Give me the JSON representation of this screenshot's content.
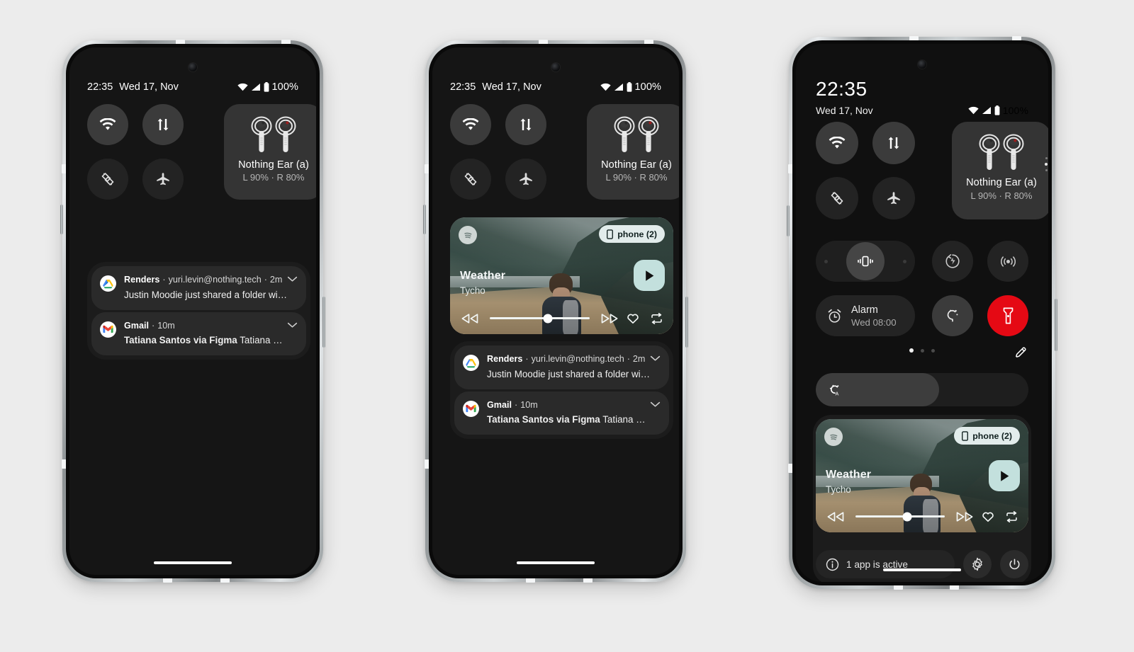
{
  "page": {
    "background_color": "#ececec",
    "device_count": 3
  },
  "status_bar": {
    "time": "22:35",
    "date": "Wed 17, Nov",
    "battery_percent": "100%",
    "icons": [
      "wifi-icon",
      "cellular-signal-icon",
      "battery-icon"
    ]
  },
  "quick_settings": {
    "tiles": [
      {
        "name": "wifi",
        "icon": "wifi-icon",
        "state": "on"
      },
      {
        "name": "mobile-data",
        "icon": "data-transfer-icon",
        "state": "on"
      },
      {
        "name": "auto-rotate",
        "icon": "auto-rotate-icon",
        "state": "off"
      },
      {
        "name": "airplane-mode",
        "icon": "airplane-icon",
        "state": "off"
      }
    ],
    "bluetooth_device": {
      "icon": "earbuds-icon",
      "name": "Nothing Ear (a)",
      "battery": "L 90% · R 80%"
    },
    "ringer_modes": [
      {
        "name": "silent",
        "icon": "mute-icon",
        "state": "off"
      },
      {
        "name": "vibrate",
        "icon": "vibrate-icon",
        "state": "on"
      },
      {
        "name": "ring",
        "icon": "ring-icon",
        "state": "off"
      }
    ],
    "extra_tiles": [
      {
        "name": "battery-share",
        "icon": "battery-share-icon",
        "state": "off"
      },
      {
        "name": "hotspot",
        "icon": "hotspot-icon",
        "state": "off"
      }
    ],
    "alarm": {
      "icon": "alarm-clock-icon",
      "label": "Alarm",
      "value": "Wed 08:00"
    },
    "colour_tile": {
      "name": "color-temperature",
      "icon": "color-temp-icon"
    },
    "flashlight": {
      "name": "flashlight",
      "icon": "flashlight-icon",
      "color": "#e50914",
      "state": "on"
    },
    "pages": {
      "count": 3,
      "current": 1
    },
    "edit_button": {
      "name": "edit-tiles",
      "icon": "pencil-icon"
    },
    "brightness": {
      "icon": "auto-brightness-icon",
      "value_percent": 58
    }
  },
  "notifications": [
    {
      "app": "Renders",
      "meta": "yuri.levin@nothing.tech",
      "time": "2m",
      "separator": "·",
      "body": "Justin Moodie just shared a folder with you",
      "icon": "google-drive-icon",
      "expand_icon": "chevron-down-icon"
    },
    {
      "app": "Gmail",
      "meta": "",
      "time": "10m",
      "separator": "·",
      "body_bold": "Tatiana Santos via Figma",
      "body": "Tatiana mention...",
      "icon": "gmail-icon",
      "expand_icon": "chevron-down-icon"
    }
  ],
  "media_player": {
    "app_icon": "spotify-icon",
    "device_chip": {
      "icon": "phone-icon",
      "label": "phone (2)"
    },
    "title": "Weather",
    "artist": "Tycho",
    "progress_percent": 58,
    "controls": [
      {
        "name": "rewind",
        "icon": "rewind-icon"
      },
      {
        "name": "fast-forward",
        "icon": "fast-forward-icon"
      },
      {
        "name": "favourite",
        "icon": "heart-icon"
      },
      {
        "name": "repeat",
        "icon": "repeat-icon"
      }
    ],
    "play_button": {
      "name": "play",
      "icon": "play-icon",
      "color": "#c3e0dd"
    },
    "artwork_description": "coastal-cliff-beach-photo"
  },
  "footer": {
    "active_apps": {
      "icon": "info-icon",
      "label": "1 app is active"
    },
    "settings_button": {
      "name": "settings",
      "icon": "gear-icon"
    },
    "power_button": {
      "name": "power",
      "icon": "power-icon"
    }
  }
}
